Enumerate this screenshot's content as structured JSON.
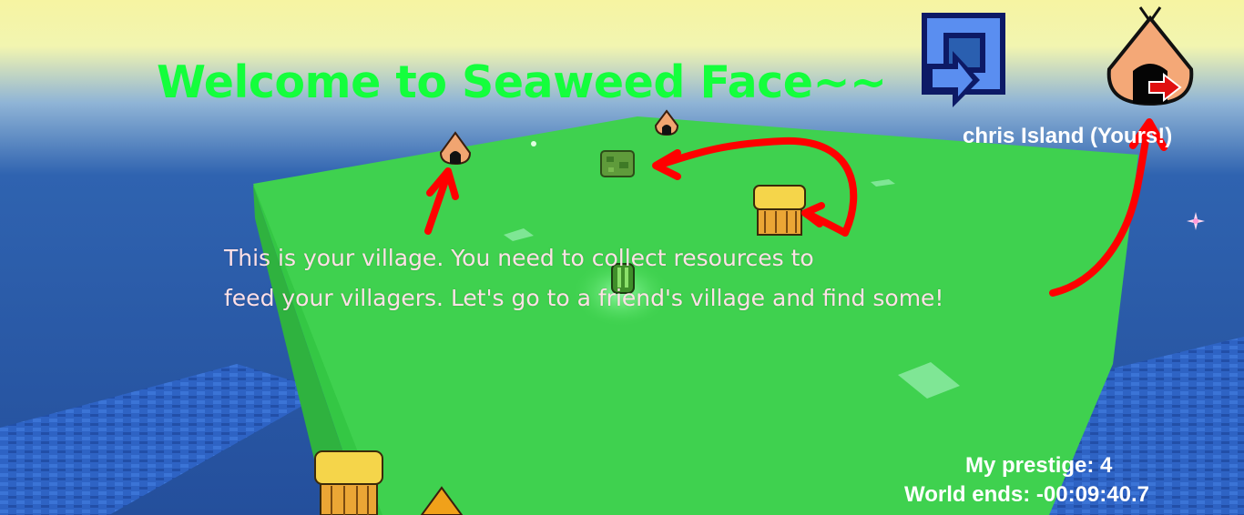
{
  "hud": {
    "title": "Welcome to Seaweed Face~~",
    "tutorial_line1": "This is your village. You need to collect resources to",
    "tutorial_line2": "feed your villagers. Let's go to a friend's village and find some!",
    "island_name": "chris Island (Yours!)",
    "prestige": "My prestige: 4",
    "world_ends": "World ends: -00:09:40.7"
  },
  "buttons": {
    "back_icon": "return-arrow-icon",
    "home_icon": "home-hut-icon"
  },
  "colors": {
    "title": "#14ff3c",
    "tutorial_text": "#ffe0e6",
    "hud_text": "#ffffff",
    "island": "#3fd14f",
    "ocean": "#2a5fb0",
    "sky_glow": "#f4f6a8",
    "annotation_arrows": "#ff0000"
  }
}
